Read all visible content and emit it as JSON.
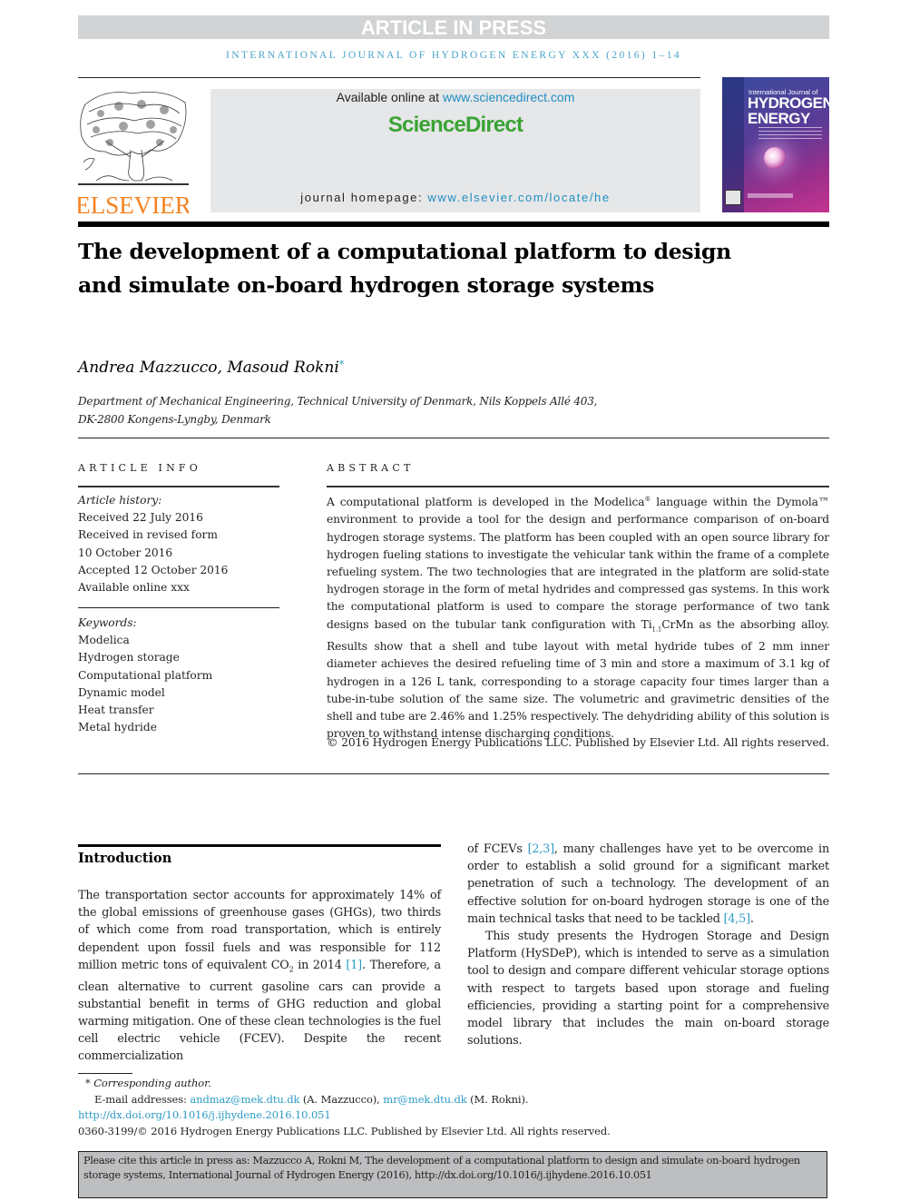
{
  "banner": {
    "label": "ARTICLE IN PRESS"
  },
  "journal_running_head": "INTERNATIONAL JOURNAL OF HYDROGEN ENERGY XXX (2016) 1–14",
  "header": {
    "publisher_logo_text": "ELSEVIER",
    "available_online_prefix": "Available online at ",
    "available_online_link": "www.sciencedirect.com",
    "brand": "ScienceDirect",
    "homepage_prefix": "journal homepage: ",
    "homepage_link": "www.elsevier.com/locate/he",
    "cover": {
      "line1": "International Journal of",
      "line2": "HYDROGEN",
      "line3": "ENERGY"
    }
  },
  "article": {
    "title": "The development of a computational platform to design and simulate on-board hydrogen storage systems",
    "authors": "Andrea Mazzucco, Masoud Rokni",
    "author_mark": "*",
    "affiliation_line1": "Department of Mechanical Engineering, Technical University of Denmark, Nils Koppels Allé 403,",
    "affiliation_line2": "DK-2800 Kongens-Lyngby, Denmark"
  },
  "article_info": {
    "heading": "ARTICLE INFO",
    "history_label": "Article history:",
    "history": [
      "Received 22 July 2016",
      "Received in revised form",
      "10 October 2016",
      "Accepted 12 October 2016",
      "Available online xxx"
    ],
    "keywords_label": "Keywords:",
    "keywords": [
      "Modelica",
      "Hydrogen storage",
      "Computational platform",
      "Dynamic model",
      "Heat transfer",
      "Metal hydride"
    ]
  },
  "abstract": {
    "heading": "ABSTRACT",
    "p1": "A computational platform is developed in the Modelica",
    "reg": "®",
    "p2": " language within the Dymola™ environment to provide a tool for the design and performance comparison of on-board hydrogen storage systems. The platform has been coupled with an open source library for hydrogen fueling stations to investigate the vehicular tank within the frame of a complete refueling system. The two technologies that are integrated in the platform are solid-state hydrogen storage in the form of metal hydrides and compressed gas systems. In this work the computational platform is used to compare the storage performance of two tank designs based on the tubular tank configuration with Ti",
    "sub": "1.1",
    "p3": "CrMn as the absorbing alloy. Results show that a shell and tube layout with metal hydride tubes of 2 mm inner diameter achieves the desired refueling time of 3 min and store a maximum of 3.1 kg of hydrogen in a 126 L tank, corresponding to a storage capacity four times larger than a tube-in-tube solution of the same size. The volumetric and gravimetric densities of the shell and tube are 2.46% and 1.25% respectively. The dehydriding ability of this solution is proven to withstand intense discharging conditions.",
    "copyright": "© 2016 Hydrogen Energy Publications LLC. Published by Elsevier Ltd. All rights reserved."
  },
  "introduction": {
    "heading": "Introduction",
    "left_a": "The transportation sector accounts for approximately 14% of the global emissions of greenhouse gases (GHGs), two thirds of which come from road transportation, which is entirely dependent upon fossil fuels and was responsible for 112 million metric tons of equivalent CO",
    "left_sub": "2",
    "left_b": " in 2014 ",
    "ref1": "[1]",
    "left_c": ". Therefore, a clean alternative to current gasoline cars can provide a substantial benefit in terms of GHG reduction and global warming mitigation. One of these clean technologies is the fuel cell electric vehicle (FCEV). Despite the recent commercialization",
    "right_a": "of FCEVs ",
    "ref2": "[2,3]",
    "right_b": ", many challenges have yet to be overcome in order to establish a solid ground for a significant market penetration of such a technology. The development of an effective solution for on-board hydrogen storage is one of the main technical tasks that need to be tackled ",
    "ref3": "[4,5]",
    "right_c": ".",
    "right_p2": "This study presents the Hydrogen Storage and Design Platform (HySDeP), which is intended to serve as a simulation tool to design and compare different vehicular storage options with respect to targets based upon storage and fueling efficiencies, providing a starting point for a comprehensive model library that includes the main on-board storage solutions."
  },
  "footnotes": {
    "corresponding": "* Corresponding author.",
    "email_label": "E-mail addresses: ",
    "email1": "andmaz@mek.dtu.dk",
    "email1_name": " (A. Mazzucco), ",
    "email2": "mr@mek.dtu.dk",
    "email2_name": " (M. Rokni).",
    "doi": "http://dx.doi.org/10.1016/j.ijhydene.2016.10.051",
    "issn_line": "0360-3199/© 2016 Hydrogen Energy Publications LLC. Published by Elsevier Ltd. All rights reserved."
  },
  "citation_box": {
    "text": "Please cite this article in press as: Mazzucco A, Rokni M, The development of a computational platform to design and simulate on-board hydrogen storage systems, International Journal of Hydrogen Energy (2016), http://dx.doi.org/10.1016/j.ijhydene.2016.10.051"
  },
  "colors": {
    "link": "#2c9bc6",
    "brand_green": "#3aa335",
    "elsevier_orange": "#f58220",
    "banner_gray": "#d1d3d4"
  }
}
